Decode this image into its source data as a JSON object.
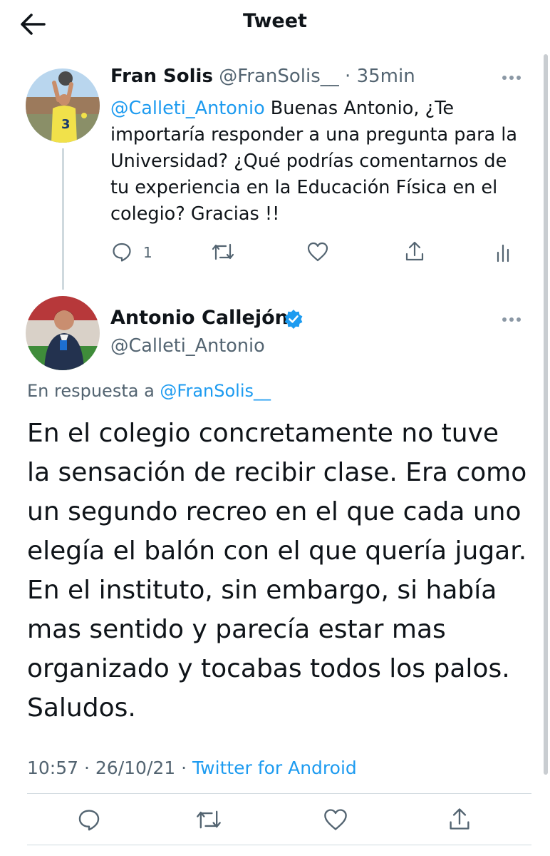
{
  "header": {
    "title": "Tweet",
    "back_icon": "arrow-left-icon"
  },
  "parent_tweet": {
    "author_name": "Fran Solis",
    "author_handle": "@FranSolis__",
    "separator": "·",
    "time": "35min",
    "mention": "@Calleti_Antonio",
    "text": " Buenas Antonio, ¿Te importaría responder a una pregunta para la Universidad? ¿Qué podrías comentarnos de tu experiencia en la Educación Física en el colegio? Gracias !!",
    "reply_count": "1"
  },
  "main_tweet": {
    "author_name": "Antonio Callejón",
    "author_handle": "@Calleti_Antonio",
    "reply_to_prefix": "En respuesta a ",
    "reply_to_handle": "@FranSolis__",
    "text": "En el colegio concretamente no tuve la sensación de recibir clase. Era como un segundo recreo en el que cada uno elegía el balón con el que quería jugar. En el instituto, sin embargo, si había mas sentido y parecía estar mas organizado y tocabas todos los palos. Saludos.",
    "time": "10:57",
    "separator": "·",
    "date": "26/10/21",
    "source": "Twitter for Android"
  },
  "colors": {
    "accent": "#1d9bf0",
    "text": "#0f1419",
    "muted": "#536471",
    "divider": "#cfd9de"
  }
}
